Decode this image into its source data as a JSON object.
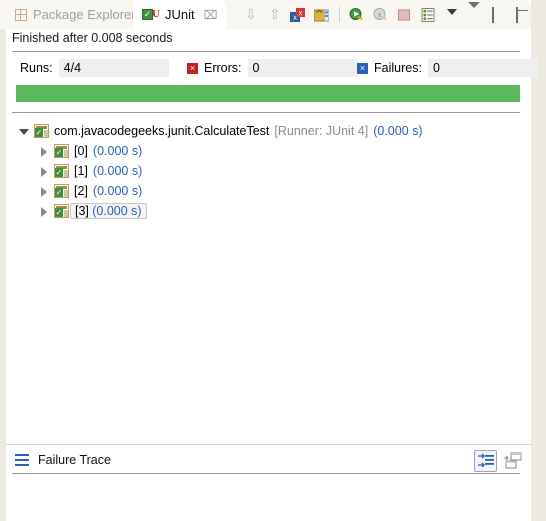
{
  "window": {
    "background_color": "#ebe9e0",
    "view_background": "#ffffff"
  },
  "tabs": [
    {
      "label": "Package Explorer",
      "icon": "package-explorer-icon",
      "active": false,
      "closable": false
    },
    {
      "label": "JUnit",
      "icon": "junit-icon",
      "active": true,
      "closable": true,
      "close_glyph": "⌧"
    }
  ],
  "toolbar": {
    "buttons": [
      {
        "name": "next-failed-test-button",
        "icon": "arrow-down-icon",
        "glyph": "⇩",
        "tooltip": "Next Failed Test"
      },
      {
        "name": "previous-failed-test-button",
        "icon": "arrow-up-icon",
        "glyph": "⇧",
        "tooltip": "Previous Failed Test"
      },
      {
        "name": "show-failures-only-button",
        "icon": "filter-failures-icon",
        "tooltip": "Show Failures Only"
      },
      {
        "name": "scroll-lock-button",
        "icon": "lock-icon",
        "tooltip": "Scroll Lock"
      },
      {
        "name": "rerun-test-button",
        "icon": "rerun-green-icon",
        "tooltip": "Rerun Test"
      },
      {
        "name": "rerun-failed-tests-button",
        "icon": "rerun-failed-icon",
        "tooltip": "Rerun Test - Failures First"
      },
      {
        "name": "stop-button",
        "icon": "stop-icon",
        "tooltip": "Stop JUnit Test Run"
      },
      {
        "name": "test-run-history-button",
        "icon": "history-list-icon",
        "tooltip": "Test Run History"
      },
      {
        "name": "toolbar-dropdown-button",
        "icon": "chevron-down-icon",
        "glyph": "▼",
        "tooltip": "More"
      }
    ],
    "view_controls": [
      {
        "name": "view-menu-button",
        "icon": "view-menu-chevron-icon",
        "tooltip": "View Menu"
      },
      {
        "name": "minimize-view-button",
        "icon": "minimize-icon",
        "tooltip": "Minimize"
      },
      {
        "name": "maximize-view-button",
        "icon": "maximize-icon",
        "tooltip": "Maximize"
      }
    ]
  },
  "status": {
    "text": "Finished after 0.008 seconds"
  },
  "counters": {
    "runs": {
      "label": "Runs:",
      "value": "4/4"
    },
    "errors": {
      "label": "Errors:",
      "value": "0",
      "icon": "error-x-icon",
      "icon_color": "#c5221f",
      "glyph": "×"
    },
    "failures": {
      "label": "Failures:",
      "value": "0",
      "icon": "failure-x-icon",
      "icon_color": "#2b5fb8",
      "glyph": "×"
    }
  },
  "progress": {
    "percent": 100,
    "color": "#5cb85c",
    "state": "passed"
  },
  "tree": {
    "root": {
      "name": "com.javacodegeeks.junit.CalculateTest",
      "runner": "[Runner: JUnit 4]",
      "time": "(0.000 s)",
      "expanded": true,
      "icon": "test-suite-pass-icon"
    },
    "children": [
      {
        "name": "[0]",
        "time": "(0.000 s)",
        "expanded": false,
        "selected": false,
        "icon": "test-pass-icon"
      },
      {
        "name": "[1]",
        "time": "(0.000 s)",
        "expanded": false,
        "selected": false,
        "icon": "test-pass-icon"
      },
      {
        "name": "[2]",
        "time": "(0.000 s)",
        "expanded": false,
        "selected": false,
        "icon": "test-pass-icon"
      },
      {
        "name": "[3]",
        "time": "(0.000 s)",
        "expanded": false,
        "selected": true,
        "icon": "test-pass-icon"
      }
    ]
  },
  "failure_trace": {
    "title": "Failure Trace",
    "icon": "failure-trace-icon",
    "content": "",
    "buttons": [
      {
        "name": "filter-stack-trace-button",
        "icon": "filter-stack-trace-icon",
        "active": true
      },
      {
        "name": "compare-result-button",
        "icon": "compare-result-icon",
        "active": false
      }
    ]
  }
}
